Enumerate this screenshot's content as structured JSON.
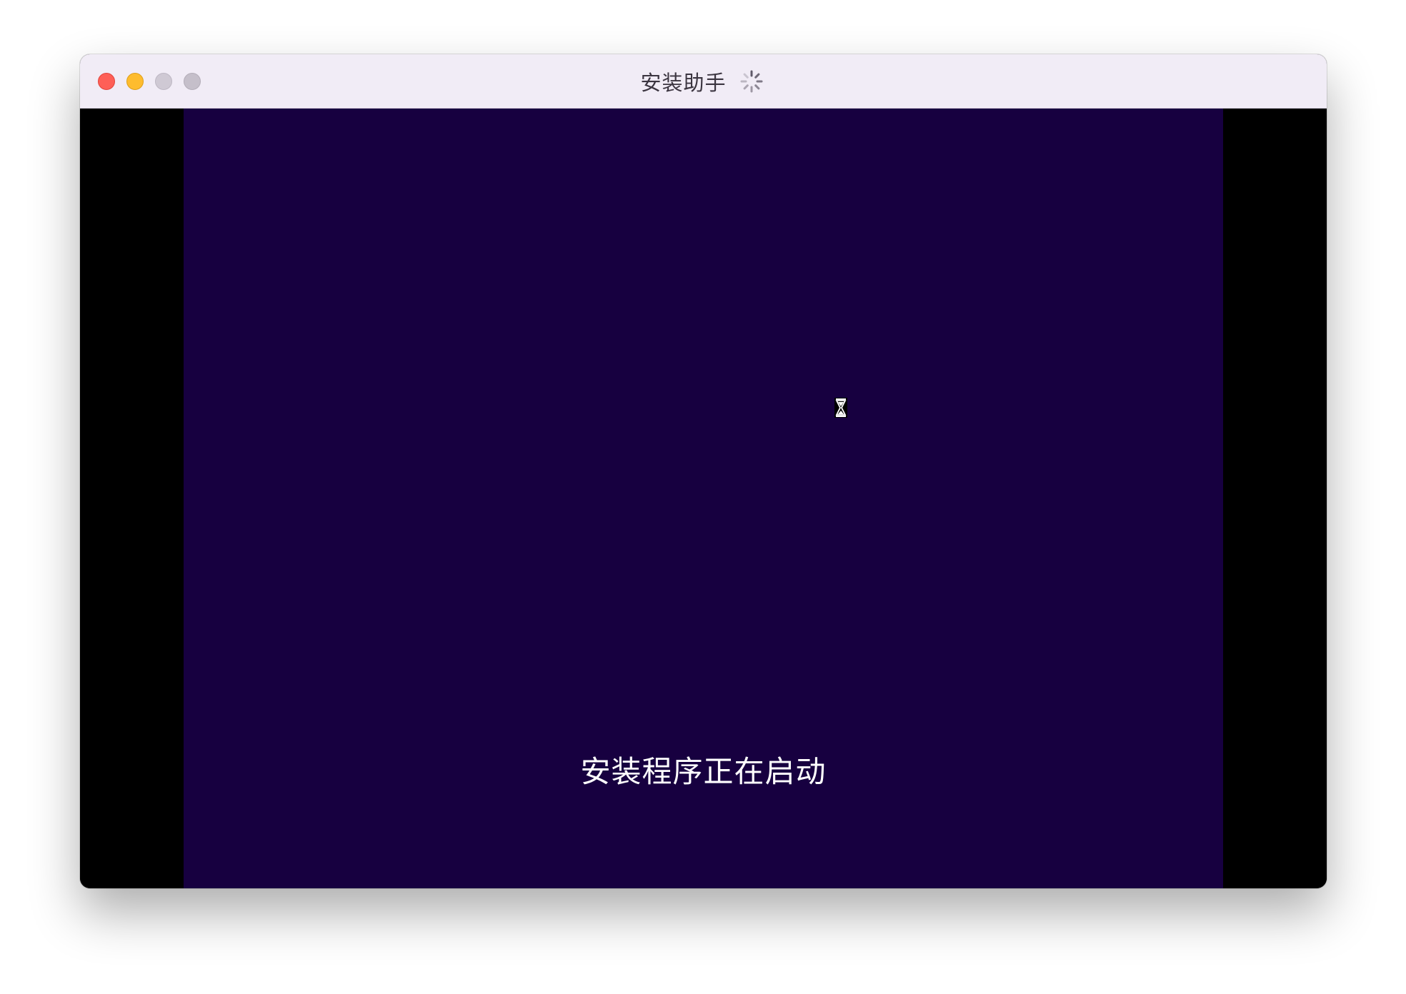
{
  "window": {
    "title": "安装助手",
    "titlebar_color": "#f1ecf6",
    "controls": [
      "close",
      "minimize",
      "extra",
      "zoom"
    ],
    "activity_indicator": "spinner-icon"
  },
  "vm_screen": {
    "background_color": "#170040",
    "letterbox_color": "#000000",
    "cursor": "hourglass-icon",
    "status_text": "安装程序正在启动"
  },
  "colors": {
    "close": "#fe5f57",
    "minimize": "#febc2e",
    "inactive": "#cfc9d4",
    "text_on_screen": "#ffffff"
  }
}
